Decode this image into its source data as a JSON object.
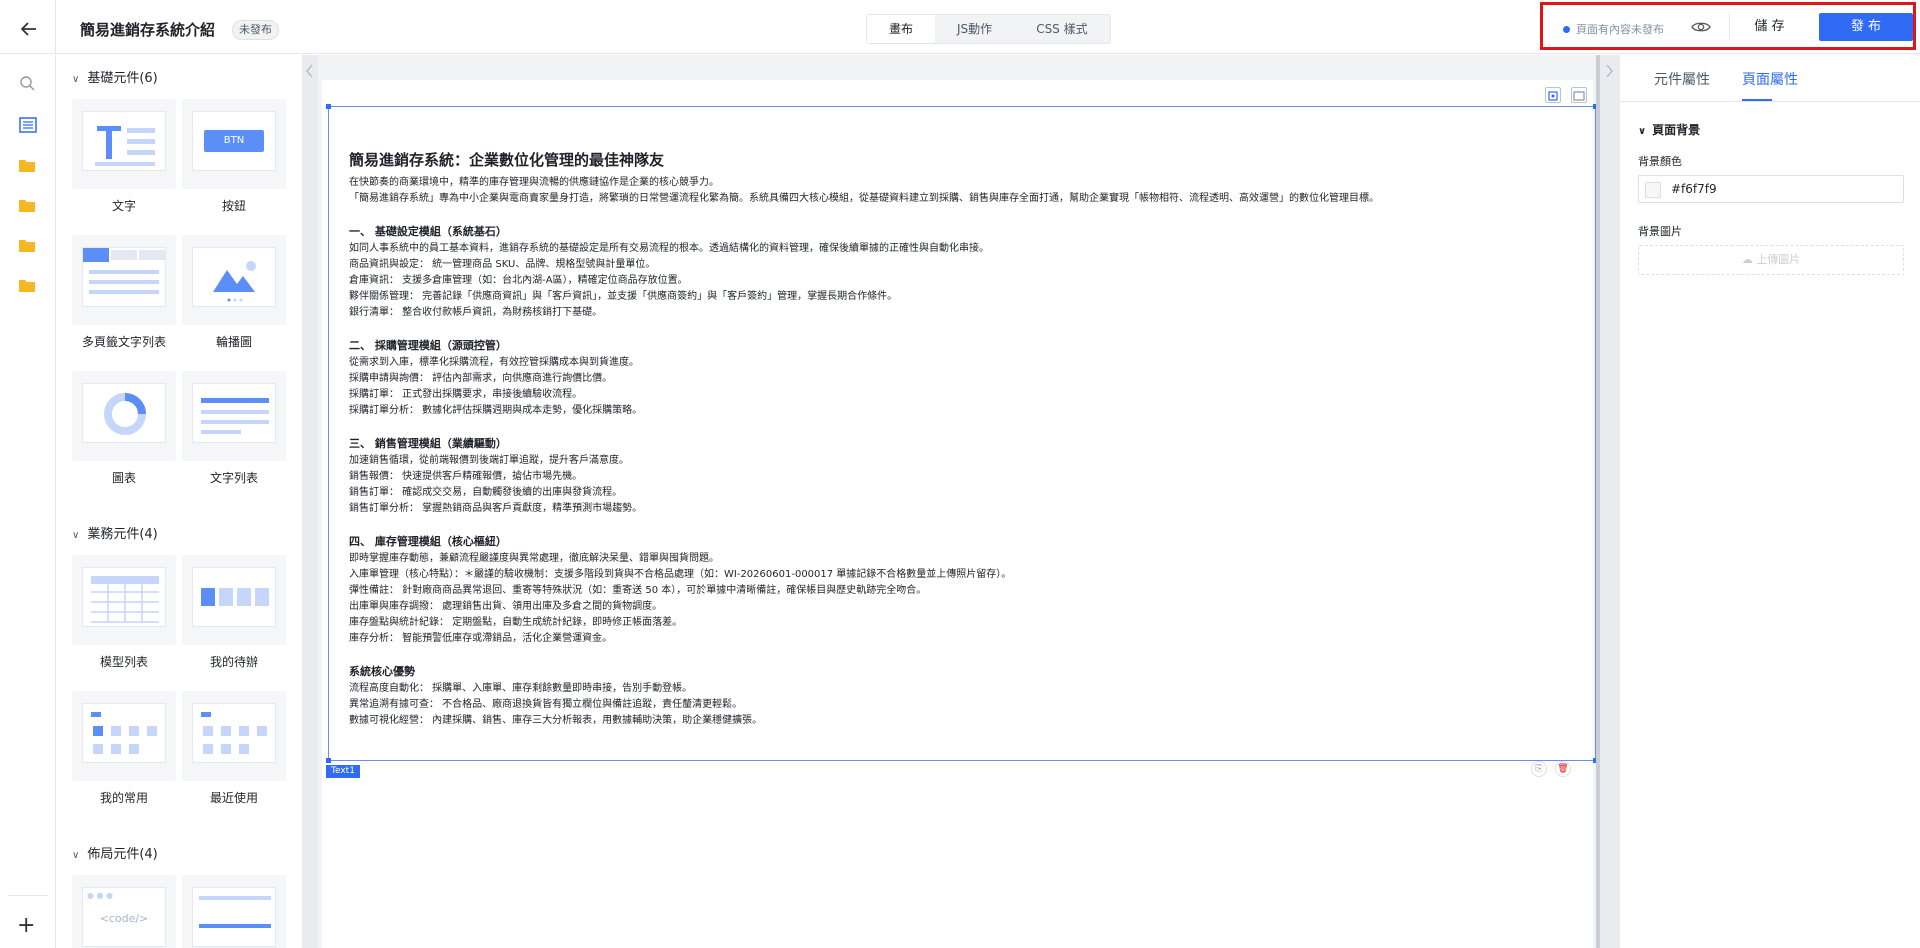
{
  "header": {
    "title": "簡易進銷存系統介紹",
    "status_badge": "未發布",
    "tabs": [
      "畫布",
      "JS動作",
      "CSS 樣式"
    ],
    "unsaved_notice": "頁面有內容未發布",
    "save_label": "儲 存",
    "publish_label": "發 布"
  },
  "rail": {
    "icons": [
      "search-icon",
      "list-icon",
      "folder-icon",
      "folder-icon",
      "folder-icon",
      "folder-icon"
    ],
    "add_label": "+"
  },
  "library": {
    "groups": [
      {
        "title": "基礎元件(6)",
        "items": [
          "文字",
          "按鈕",
          "多頁籤文字列表",
          "輪播圖",
          "圖表",
          "文字列表"
        ]
      },
      {
        "title": "業務元件(4)",
        "items": [
          "模型列表",
          "我的待辦",
          "我的常用",
          "最近使用"
        ]
      },
      {
        "title": "佈局元件(4)",
        "items": []
      }
    ],
    "btn_thumb_label": "BTN",
    "code_thumb_label": "<code/>"
  },
  "canvas": {
    "component_tag": "Text1",
    "doc": {
      "title": "簡易進銷存系統：企業數位化管理的最佳神隊友",
      "intro": [
        "在快節奏的商業環境中，精準的庫存管理與流暢的供應鏈協作是企業的核心競爭力。",
        "「簡易進銷存系統」專為中小企業與電商賣家量身打造，將繁瑣的日常營運流程化繁為簡。系統具備四大核心模組，從基礎資料建立到採購、銷售與庫存全面打通，幫助企業實現「帳物相符、流程透明、高效運營」的數位化管理目標。"
      ],
      "sections": [
        {
          "heading": "一、 基礎設定模組（系統基石）",
          "lines": [
            "如同人事系統中的員工基本資料，進銷存系統的基礎設定是所有交易流程的根本。透過結構化的資料管理，確保後續單據的正確性與自動化串接。",
            "商品資訊與設定： 統一管理商品 SKU、品牌、規格型號與計量單位。",
            "倉庫資訊： 支援多倉庫管理（如：台北內湖-A區），精確定位商品存放位置。",
            "夥伴關係管理： 完善記錄「供應商資訊」與「客戶資訊」，並支援「供應商簽約」與「客戶簽約」管理，掌握長期合作條件。",
            "銀行清單： 整合收付款帳戶資訊，為財務核銷打下基礎。"
          ]
        },
        {
          "heading": "二、 採購管理模組（源頭控管）",
          "lines": [
            "從需求到入庫，標準化採購流程，有效控管採購成本與到貨進度。",
            "採購申請與詢價： 評估內部需求，向供應商進行詢價比價。",
            "採購訂單： 正式發出採購要求，串接後續驗收流程。",
            "採購訂單分析： 數據化評估採購週期與成本走勢，優化採購策略。"
          ]
        },
        {
          "heading": "三、 銷售管理模組（業績驅動）",
          "lines": [
            "加速銷售循環，從前端報價到後端訂單追蹤，提升客戶滿意度。",
            "銷售報價： 快速提供客戶精確報價，搶佔市場先機。",
            "銷售訂單： 確認成交交易，自動觸發後續的出庫與發貨流程。",
            "銷售訂單分析： 掌握熱銷商品與客戶貢獻度，精準預測市場趨勢。"
          ]
        },
        {
          "heading": "四、 庫存管理模組（核心樞紐）",
          "lines": [
            "即時掌握庫存動態，兼顧流程嚴謹度與異常處理，徹底解決呆量、錯單與囤貨問題。",
            "入庫單管理（核心特點）：＊嚴謹的驗收機制：支援多階段到貨與不合格品處理（如：WI-20260601-000017 單據記錄不合格數量並上傳照片留存）。",
            "彈性備註： 針對廠商商品異常退回、重寄等特殊狀況（如：重寄送 50 本），可於單據中清晰備註，確保帳目與歷史軌跡完全吻合。",
            "出庫單與庫存調撥： 處理銷售出貨、領用出庫及多倉之間的貨物調度。",
            "庫存盤點與統計紀錄： 定期盤點，自動生成統計紀錄，即時修正帳面落差。",
            "庫存分析： 智能預警低庫存或滯銷品，活化企業營運資金。"
          ]
        },
        {
          "heading": "系統核心優勢",
          "lines": [
            "流程高度自動化： 採購單、入庫單、庫存剩餘數量即時串接，告別手動登帳。",
            "異常追溯有據可查： 不合格品、廠商退換貨皆有獨立欄位與備註追蹤，責任釐清更輕鬆。",
            "數據可視化經營： 內建採購、銷售、庫存三大分析報表，用數據輔助決策，助企業穩健擴張。"
          ]
        }
      ]
    }
  },
  "properties": {
    "tabs": [
      "元件屬性",
      "頁面屬性"
    ],
    "active_tab": "頁面屬性",
    "section_title": "頁面背景",
    "bg_color_label": "背景顏色",
    "bg_color_value": "#f6f7f9",
    "bg_image_label": "背景圖片",
    "upload_label": "上傳圖片"
  },
  "colors": {
    "accent": "#2f6bf5",
    "highlight_border": "#e0151a"
  }
}
